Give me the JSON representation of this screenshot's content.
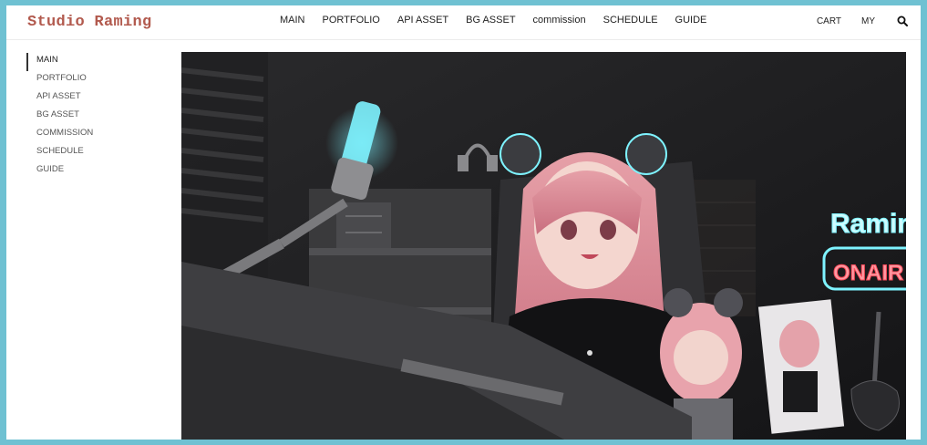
{
  "brand": {
    "logo_text": "Studio Raming"
  },
  "top_menu": [
    {
      "label": "MAIN"
    },
    {
      "label": "PORTFOLIO"
    },
    {
      "label": "API ASSET"
    },
    {
      "label": "BG ASSET"
    },
    {
      "label": "commission"
    },
    {
      "label": "SCHEDULE"
    },
    {
      "label": "GUIDE"
    }
  ],
  "right_links": {
    "cart": "CART",
    "my": "MY"
  },
  "search": {
    "icon": "search-icon"
  },
  "sidebar": {
    "items": [
      {
        "label": "MAIN",
        "active": true
      },
      {
        "label": "PORTFOLIO",
        "active": false
      },
      {
        "label": "API ASSET",
        "active": false
      },
      {
        "label": "BG ASSET",
        "active": false
      },
      {
        "label": "COMMISSION",
        "active": false
      },
      {
        "label": "SCHEDULE",
        "active": false
      },
      {
        "label": "GUIDE",
        "active": false
      }
    ]
  },
  "hero": {
    "neon_sign_name": "Ramin",
    "neon_sign_status": "ONAIR"
  },
  "colors": {
    "frame_border": "#6fc1d2",
    "logo": "#b25a4e",
    "neon_cyan": "#7ef3ff",
    "neon_red": "#ff4a5a"
  }
}
